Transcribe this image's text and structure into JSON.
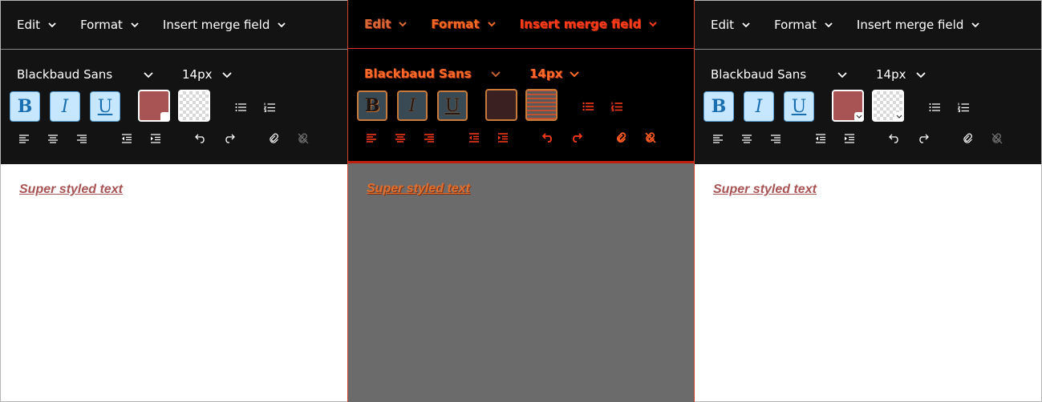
{
  "panels": [
    {
      "menus": [
        {
          "label": "Edit"
        },
        {
          "label": "Format"
        },
        {
          "label": "Insert merge field"
        }
      ],
      "font_family": "Blackbaud Sans",
      "font_size": "14px",
      "buttons": {
        "bold": "B",
        "italic": "I",
        "underline": "U"
      },
      "content_text": "Super styled text"
    },
    {
      "menus": [
        {
          "label": "Edit"
        },
        {
          "label": "Format"
        },
        {
          "label": "Insert merge field"
        }
      ],
      "font_family": "Blackbaud Sans",
      "font_size": "14px",
      "buttons": {
        "bold": "B",
        "italic": "I",
        "underline": "U"
      },
      "content_text": "Super styled text"
    },
    {
      "menus": [
        {
          "label": "Edit"
        },
        {
          "label": "Format"
        },
        {
          "label": "Insert merge field"
        }
      ],
      "font_family": "Blackbaud Sans",
      "font_size": "14px",
      "buttons": {
        "bold": "B",
        "italic": "I",
        "underline": "U"
      },
      "content_text": "Super styled text"
    }
  ],
  "colors": {
    "toolbar_bg": "#131313",
    "text_color_swatch": "#a85454",
    "button_active_bg": "#c7e6ff",
    "button_active_fg": "#1a6fb0",
    "distorted_accent": "#ff5a1f"
  },
  "icons": [
    "chevron-down-icon",
    "bullet-list-icon",
    "numbered-list-icon",
    "align-left-icon",
    "align-center-icon",
    "align-right-icon",
    "outdent-icon",
    "indent-icon",
    "undo-icon",
    "redo-icon",
    "link-icon",
    "unlink-icon"
  ]
}
